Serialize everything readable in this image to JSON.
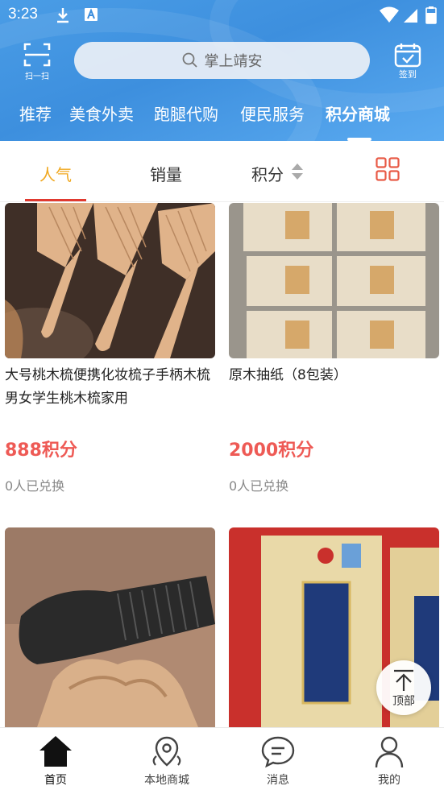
{
  "status_bar": {
    "time": "3:23"
  },
  "header": {
    "scan_label": "扫一扫",
    "search_placeholder": "掌上靖安",
    "sign_label": "签到",
    "nav_tabs": [
      "推荐",
      "美食外卖",
      "跑腿代购",
      "便民服务",
      "积分商城"
    ],
    "active_tab": "积分商城"
  },
  "sort_bar": {
    "items": [
      "人气",
      "销量",
      "积分"
    ],
    "active": "人气"
  },
  "products": [
    {
      "name": "大号桃木梳便携化妆梳子手柄木梳男女学生桃木梳家用",
      "price": "888积分",
      "sold": "0人已兑换"
    },
    {
      "name": "原木抽纸（8包装）",
      "price": "2000积分",
      "sold": "0人已兑换"
    },
    {
      "name": "",
      "price": "",
      "sold": ""
    },
    {
      "name": "",
      "price": "",
      "sold": ""
    }
  ],
  "back_to_top_label": "顶部",
  "bottom_nav": [
    {
      "label": "首页",
      "icon": "home-icon",
      "active": true
    },
    {
      "label": "本地商城",
      "icon": "location-icon",
      "active": false
    },
    {
      "label": "消息",
      "icon": "message-icon",
      "active": false
    },
    {
      "label": "我的",
      "icon": "user-icon",
      "active": false
    }
  ],
  "colors": {
    "header_blue": "#3d8fde",
    "accent_orange": "#f0a820",
    "price_red": "#ee5a55",
    "indicator_red": "#e0392f"
  }
}
